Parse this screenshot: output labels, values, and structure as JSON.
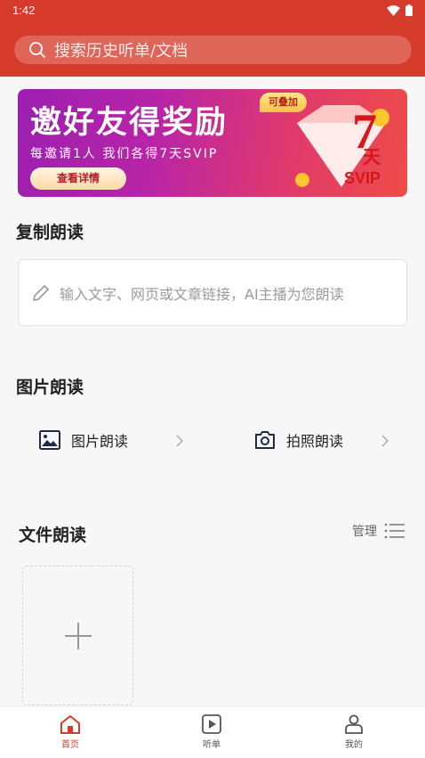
{
  "status": {
    "time": "1:42"
  },
  "search": {
    "placeholder": "搜索历史听单/文档"
  },
  "banner": {
    "title": "邀好友得奖励",
    "subtitle": "每邀请1人 我们各得7天SVIP",
    "button": "查看详情",
    "tag": "可叠加",
    "badge_number": "7",
    "badge_unit": "天",
    "badge_level": "SVIP"
  },
  "copy_read": {
    "title": "复制朗读",
    "placeholder": "输入文字、网页或文章链接，AI主播为您朗读"
  },
  "image_read": {
    "title": "图片朗读",
    "options": [
      "图片朗读",
      "拍照朗读"
    ]
  },
  "file_read": {
    "title": "文件朗读",
    "manage_label": "管理"
  },
  "nav": {
    "items": [
      {
        "label": "首页",
        "active": true
      },
      {
        "label": "听单",
        "active": false
      },
      {
        "label": "我的",
        "active": false
      }
    ]
  },
  "colors": {
    "brand": "#d63a2b",
    "active_tab": "#d63a2b",
    "inactive_tab": "#555555"
  }
}
